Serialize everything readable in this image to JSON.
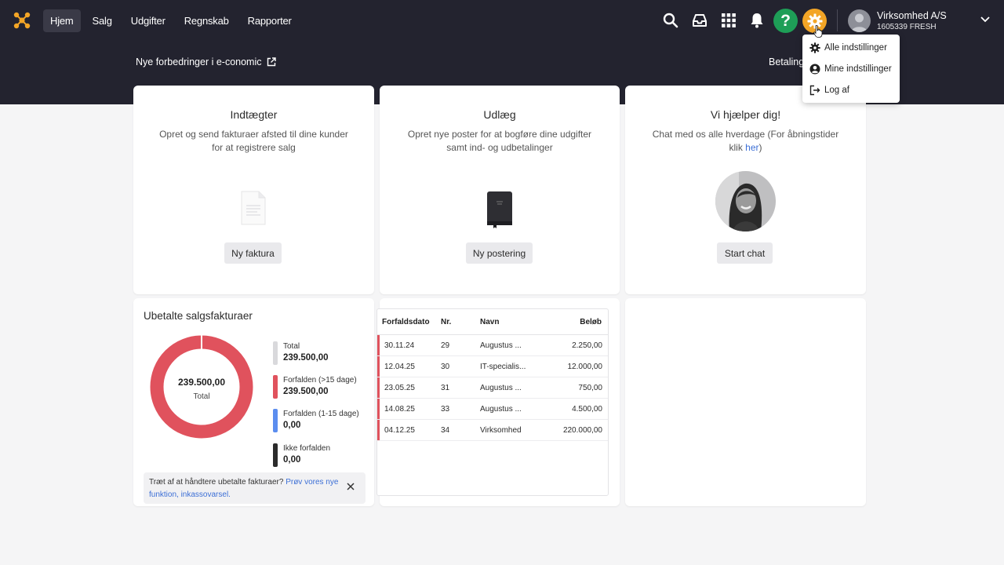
{
  "nav": {
    "items": [
      {
        "label": "Hjem",
        "active": true
      },
      {
        "label": "Salg",
        "active": false
      },
      {
        "label": "Udgifter",
        "active": false
      },
      {
        "label": "Regnskab",
        "active": false
      },
      {
        "label": "Rapporter",
        "active": false
      }
    ],
    "help_label": "?",
    "company_name": "Virksomhed A/S",
    "company_sub": "1605339 FRESH",
    "icons": [
      "search-icon",
      "inbox-icon",
      "apps-grid-icon",
      "bell-icon",
      "help-icon",
      "gear-icon",
      "avatar",
      "chevron-down-icon"
    ],
    "accent_color": "#f3a526",
    "help_color": "#1e9e57"
  },
  "band": {
    "news_label": "Nye forbedringer i e-conomic",
    "betaling_label": "Betaling"
  },
  "cards": {
    "income": {
      "title": "Indtægter",
      "description": "Opret og send fakturaer afsted til dine kunder for at registrere salg",
      "button": "Ny faktura"
    },
    "expense": {
      "title": "Udlæg",
      "description": "Opret nye poster for at bogføre dine udgifter samt ind- og udbetalinger",
      "button": "Ny postering"
    },
    "help": {
      "title": "Vi hjælper dig!",
      "description_prefix": "Chat med os alle hverdage (For åbningstider klik ",
      "description_link": "her",
      "description_suffix": ")",
      "button": "Start chat"
    }
  },
  "unpaid": {
    "title": "Ubetalte salgsfakturaer",
    "donut_value": "239.500,00",
    "donut_label": "Total",
    "overdue_fraction": 1.0,
    "legend": [
      {
        "label": "Total",
        "value": "239.500,00",
        "color": "#d9d9dc"
      },
      {
        "label": "Forfalden (>15 dage)",
        "value": "239.500,00",
        "color": "#e0525d"
      },
      {
        "label": "Forfalden (1-15 dage)",
        "value": "0,00",
        "color": "#5b8def"
      },
      {
        "label": "Ikke forfalden",
        "value": "0,00",
        "color": "#2b2b2b"
      }
    ],
    "tip_text": "Træt af at håndtere ubetalte fakturaer? ",
    "tip_link": "Prøv vores nye funktion, inkassovarsel."
  },
  "table": {
    "headers": {
      "date": "Forfaldsdato",
      "no": "Nr.",
      "name": "Navn",
      "amount": "Beløb"
    },
    "rows": [
      {
        "date": "30.11.24",
        "no": "29",
        "name": "Augustus ...",
        "amount": "2.250,00"
      },
      {
        "date": "12.04.25",
        "no": "30",
        "name": "IT-specialis...",
        "amount": "12.000,00"
      },
      {
        "date": "23.05.25",
        "no": "31",
        "name": "Augustus ...",
        "amount": "750,00"
      },
      {
        "date": "14.08.25",
        "no": "33",
        "name": "Augustus ...",
        "amount": "4.500,00"
      },
      {
        "date": "04.12.25",
        "no": "34",
        "name": "Virksomhed",
        "amount": "220.000,00"
      }
    ]
  },
  "settings_menu": {
    "items": [
      {
        "label": "Alle indstillinger",
        "icon": "gear-icon"
      },
      {
        "label": "Mine indstillinger",
        "icon": "user-circle-icon"
      },
      {
        "label": "Log af",
        "icon": "logout-icon"
      }
    ]
  }
}
